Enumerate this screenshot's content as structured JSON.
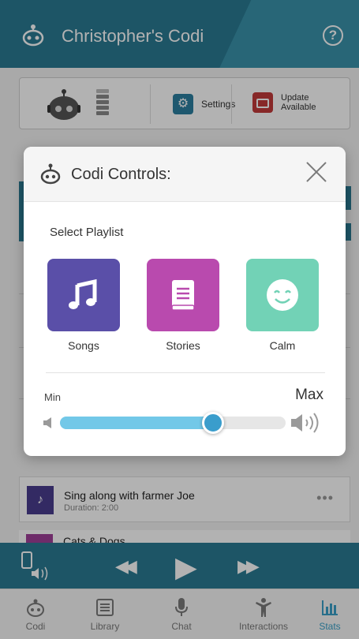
{
  "header": {
    "title": "Christopher's Codi",
    "help_glyph": "?"
  },
  "status": {
    "settings_label": "Settings",
    "update_label": "Update Available"
  },
  "list": [
    {
      "title": "Sing along with farmer Joe",
      "duration": "Duration: 2:00",
      "more": "•••"
    },
    {
      "title": "Cats & Dogs"
    }
  ],
  "modal": {
    "title": "Codi Controls:",
    "playlist_heading": "Select Playlist",
    "playlists": [
      {
        "label": "Songs",
        "color": "#5a4fa8",
        "icon": "music-note-icon"
      },
      {
        "label": "Stories",
        "color": "#b94aae",
        "icon": "book-icon"
      },
      {
        "label": "Calm",
        "color": "#72d2b6",
        "icon": "smile-icon"
      }
    ],
    "volume": {
      "min_label": "Min",
      "max_label": "Max",
      "level": 0.68
    }
  },
  "tabs": [
    {
      "label": "Codi",
      "icon": "codi-icon",
      "active": false
    },
    {
      "label": "Library",
      "icon": "library-icon",
      "active": false
    },
    {
      "label": "Chat",
      "icon": "microphone-icon",
      "active": false
    },
    {
      "label": "Interactions",
      "icon": "person-icon",
      "active": false
    },
    {
      "label": "Stats",
      "icon": "stats-icon",
      "active": true
    }
  ],
  "colors": {
    "brand": "#2a7a92",
    "accent": "#3a9dcc",
    "slider_fill": "#72c8e8"
  }
}
